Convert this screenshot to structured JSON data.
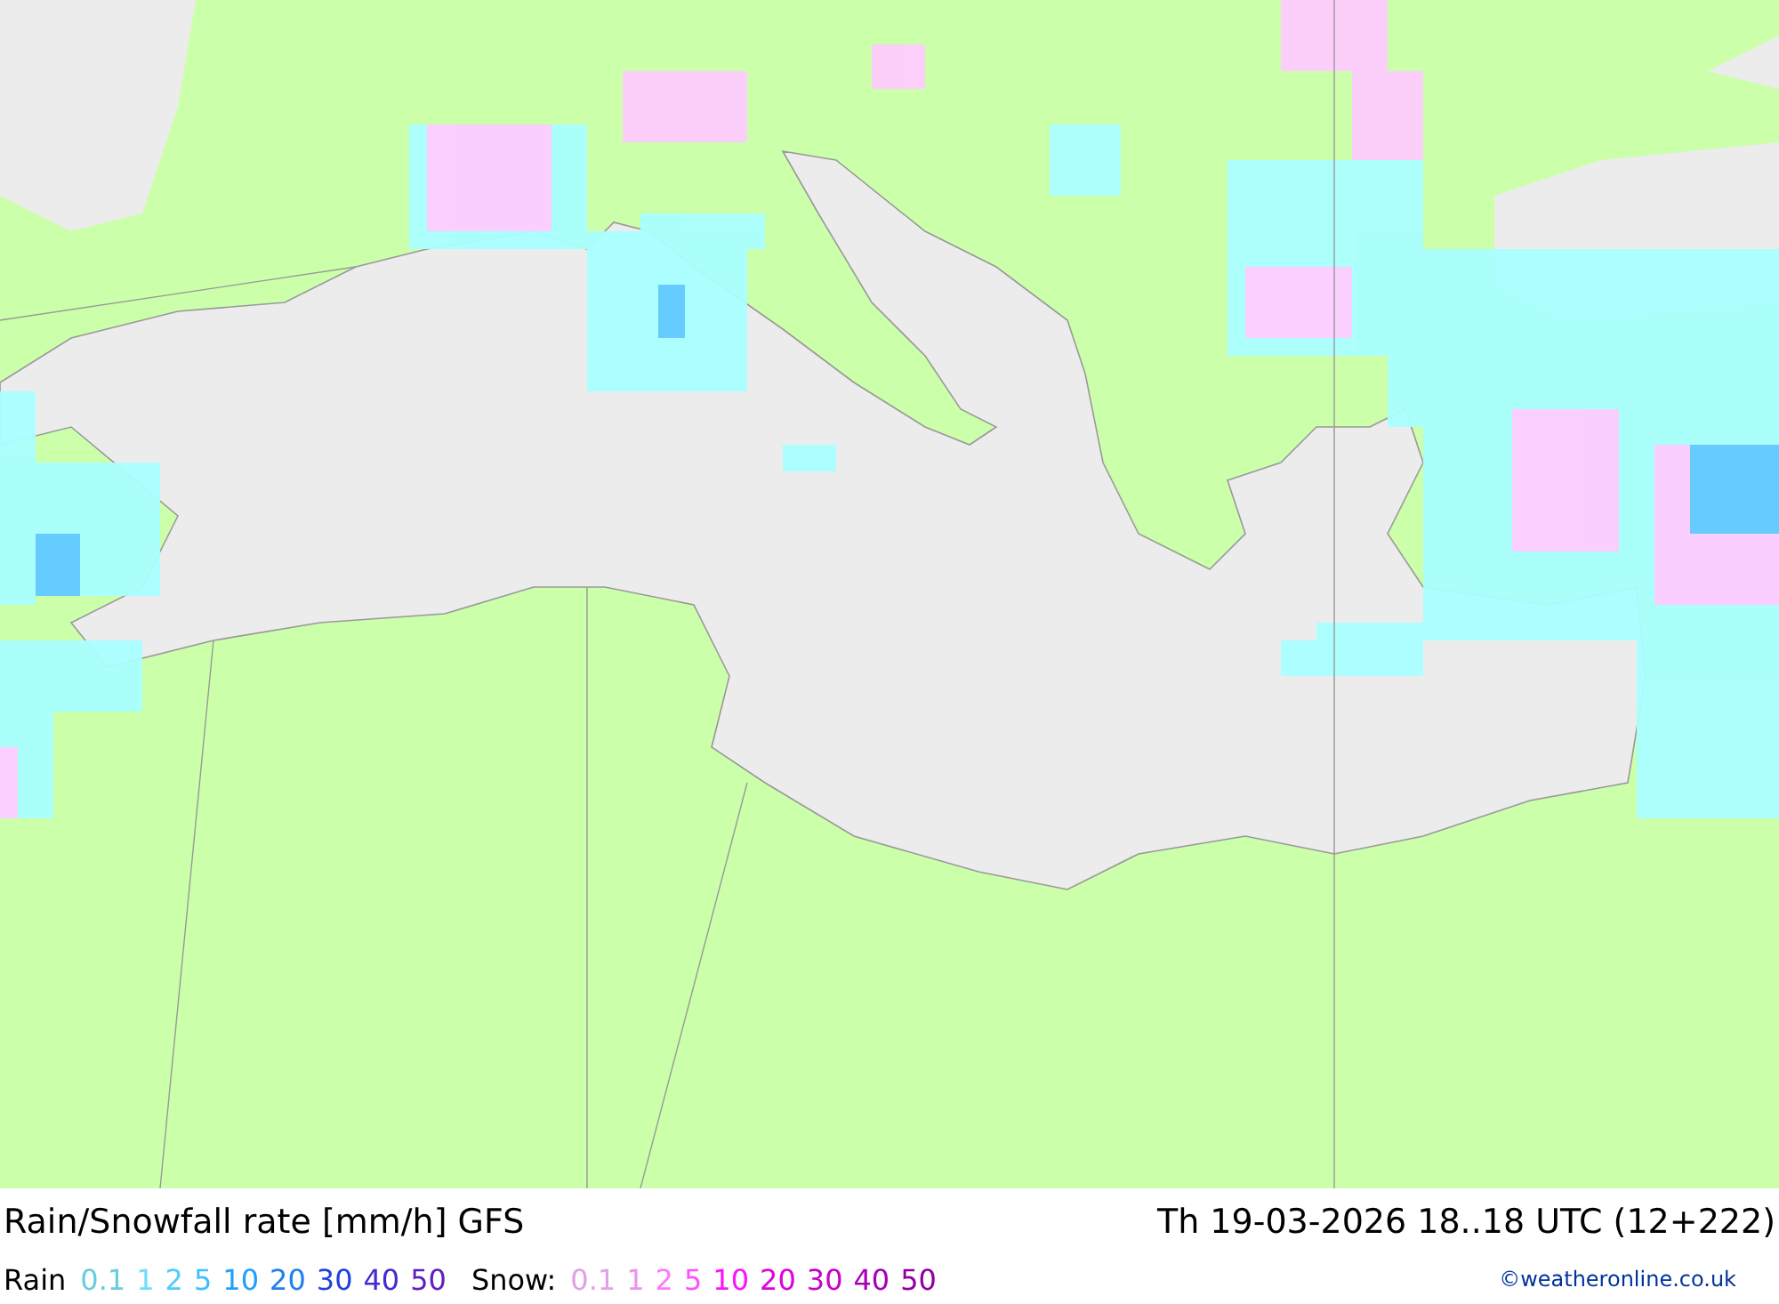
{
  "title": "Rain/Snowfall rate [mm/h] GFS",
  "valid_time": "Th 19-03-2026 18..18 UTC (12+222)",
  "rain_legend": {
    "label": "Rain",
    "items": [
      {
        "value": "0.1",
        "color": "#6cccdc"
      },
      {
        "value": "1",
        "color": "#70dcfc"
      },
      {
        "value": "2",
        "color": "#50ccfc"
      },
      {
        "value": "5",
        "color": "#40c0fc"
      },
      {
        "value": "10",
        "color": "#20a0fc"
      },
      {
        "value": "20",
        "color": "#2080f0"
      },
      {
        "value": "30",
        "color": "#2040e0"
      },
      {
        "value": "40",
        "color": "#4828d0"
      },
      {
        "value": "50",
        "color": "#6020c0"
      }
    ]
  },
  "snow_legend": {
    "label": "Snow:",
    "items": [
      {
        "value": "0.1",
        "color": "#e4a0e4"
      },
      {
        "value": "1",
        "color": "#f090f0"
      },
      {
        "value": "2",
        "color": "#ff78ff"
      },
      {
        "value": "5",
        "color": "#ff50ff"
      },
      {
        "value": "10",
        "color": "#ff10ff"
      },
      {
        "value": "20",
        "color": "#e000e0"
      },
      {
        "value": "30",
        "color": "#c800c8"
      },
      {
        "value": "40",
        "color": "#a800b8"
      },
      {
        "value": "50",
        "color": "#9000a0"
      }
    ]
  },
  "credit": "©weatheronline.co.uk"
}
